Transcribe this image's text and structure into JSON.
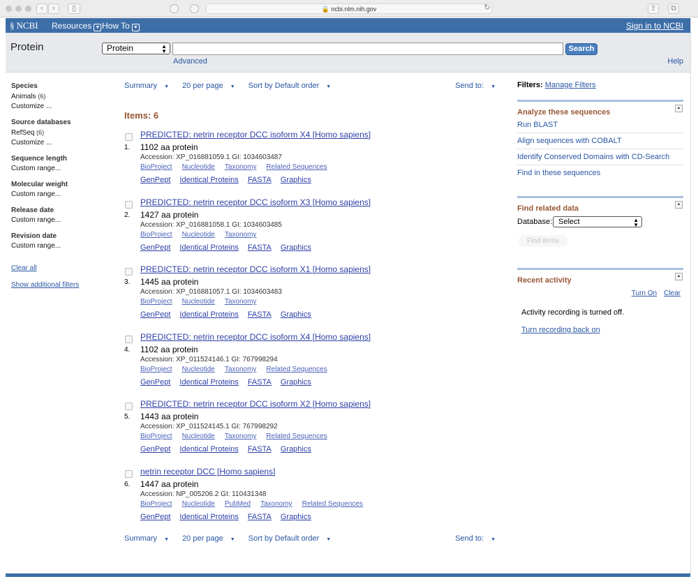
{
  "browser": {
    "url": "ncbi.nlm.nih.gov"
  },
  "header": {
    "logo": "NCBI",
    "resources": "Resources",
    "how_to": "How To",
    "sign_in": "Sign in to NCBI"
  },
  "search": {
    "db_title": "Protein",
    "db_selected": "Protein",
    "query": "",
    "button": "Search",
    "advanced": "Advanced",
    "help": "Help"
  },
  "left_filters": {
    "groups": [
      {
        "title": "Species",
        "items": [
          {
            "label": "Animals",
            "count": "(6)"
          },
          {
            "label": "Customize ...",
            "count": ""
          }
        ]
      },
      {
        "title": "Source databases",
        "items": [
          {
            "label": "RefSeq",
            "count": "(6)"
          },
          {
            "label": "Customize ...",
            "count": ""
          }
        ]
      },
      {
        "title": "Sequence length",
        "items": [
          {
            "label": "Custom range...",
            "count": ""
          }
        ]
      },
      {
        "title": "Molecular weight",
        "items": [
          {
            "label": "Custom range...",
            "count": ""
          }
        ]
      },
      {
        "title": "Release date",
        "items": [
          {
            "label": "Custom range...",
            "count": ""
          }
        ]
      },
      {
        "title": "Revision date",
        "items": [
          {
            "label": "Custom range...",
            "count": ""
          }
        ]
      }
    ],
    "clear_all": "Clear all",
    "show_additional": "Show additional filters"
  },
  "toolbar": {
    "summary": "Summary",
    "per_page": "20 per page",
    "sort": "Sort by Default order",
    "send_to": "Send to:"
  },
  "items_count": "Items: 6",
  "results": [
    {
      "num": "1.",
      "title": "PREDICTED: netrin receptor DCC isoform X4 [Homo sapiens]",
      "desc": "1102 aa protein",
      "accession": "Accession: XP_016881059.1   GI: 1034603487",
      "links1": [
        "BioProject",
        "Nucleotide",
        "Taxonomy",
        "Related Sequences"
      ],
      "links2": [
        "GenPept",
        "Identical Proteins",
        "FASTA",
        "Graphics"
      ]
    },
    {
      "num": "2.",
      "title": "PREDICTED: netrin receptor DCC isoform X3 [Homo sapiens]",
      "desc": "1427 aa protein",
      "accession": "Accession: XP_016881058.1   GI: 1034603485",
      "links1": [
        "BioProject",
        "Nucleotide",
        "Taxonomy"
      ],
      "links2": [
        "GenPept",
        "Identical Proteins",
        "FASTA",
        "Graphics"
      ]
    },
    {
      "num": "3.",
      "title": "PREDICTED: netrin receptor DCC isoform X1 [Homo sapiens]",
      "desc": "1445 aa protein",
      "accession": "Accession: XP_016881057.1   GI: 1034603483",
      "links1": [
        "BioProject",
        "Nucleotide",
        "Taxonomy"
      ],
      "links2": [
        "GenPept",
        "Identical Proteins",
        "FASTA",
        "Graphics"
      ]
    },
    {
      "num": "4.",
      "title": "PREDICTED: netrin receptor DCC isoform X4 [Homo sapiens]",
      "desc": "1102 aa protein",
      "accession": "Accession: XP_011524146.1   GI: 767998294",
      "links1": [
        "BioProject",
        "Nucleotide",
        "Taxonomy",
        "Related Sequences"
      ],
      "links2": [
        "GenPept",
        "Identical Proteins",
        "FASTA",
        "Graphics"
      ]
    },
    {
      "num": "5.",
      "title": "PREDICTED: netrin receptor DCC isoform X2 [Homo sapiens]",
      "desc": "1443 aa protein",
      "accession": "Accession: XP_011524145.1   GI: 767998292",
      "links1": [
        "BioProject",
        "Nucleotide",
        "Taxonomy",
        "Related Sequences"
      ],
      "links2": [
        "GenPept",
        "Identical Proteins",
        "FASTA",
        "Graphics"
      ]
    },
    {
      "num": "6.",
      "title": "netrin receptor DCC [Homo sapiens]",
      "desc": "1447 aa protein",
      "accession": "Accession: NP_005206.2   GI: 110431348",
      "links1": [
        "BioProject",
        "Nucleotide",
        "PubMed",
        "Taxonomy",
        "Related Sequences"
      ],
      "links2": [
        "GenPept",
        "Identical Proteins",
        "FASTA",
        "Graphics"
      ]
    }
  ],
  "right": {
    "filters_label": "Filters:",
    "manage_filters": "Manage Filters",
    "analyze": {
      "title": "Analyze these sequences",
      "links": [
        "Run BLAST",
        "Align sequences with COBALT",
        "Identify Conserved Domains with CD-Search",
        "Find in these sequences"
      ]
    },
    "related": {
      "title": "Find related data",
      "db_label": "Database:",
      "db_selected": "Select",
      "find_items": "Find items"
    },
    "recent": {
      "title": "Recent activity",
      "turn_on": "Turn On",
      "clear": "Clear",
      "status": "Activity recording is turned off.",
      "resume": "Turn recording back on"
    }
  },
  "icons": [
    "back-icon",
    "forward-icon",
    "sidebar-icon",
    "lock-icon",
    "reload-icon",
    "share-icon",
    "tabs-icon",
    "ncbi-logo-icon",
    "dropdown-icon",
    "collapse-icon"
  ]
}
